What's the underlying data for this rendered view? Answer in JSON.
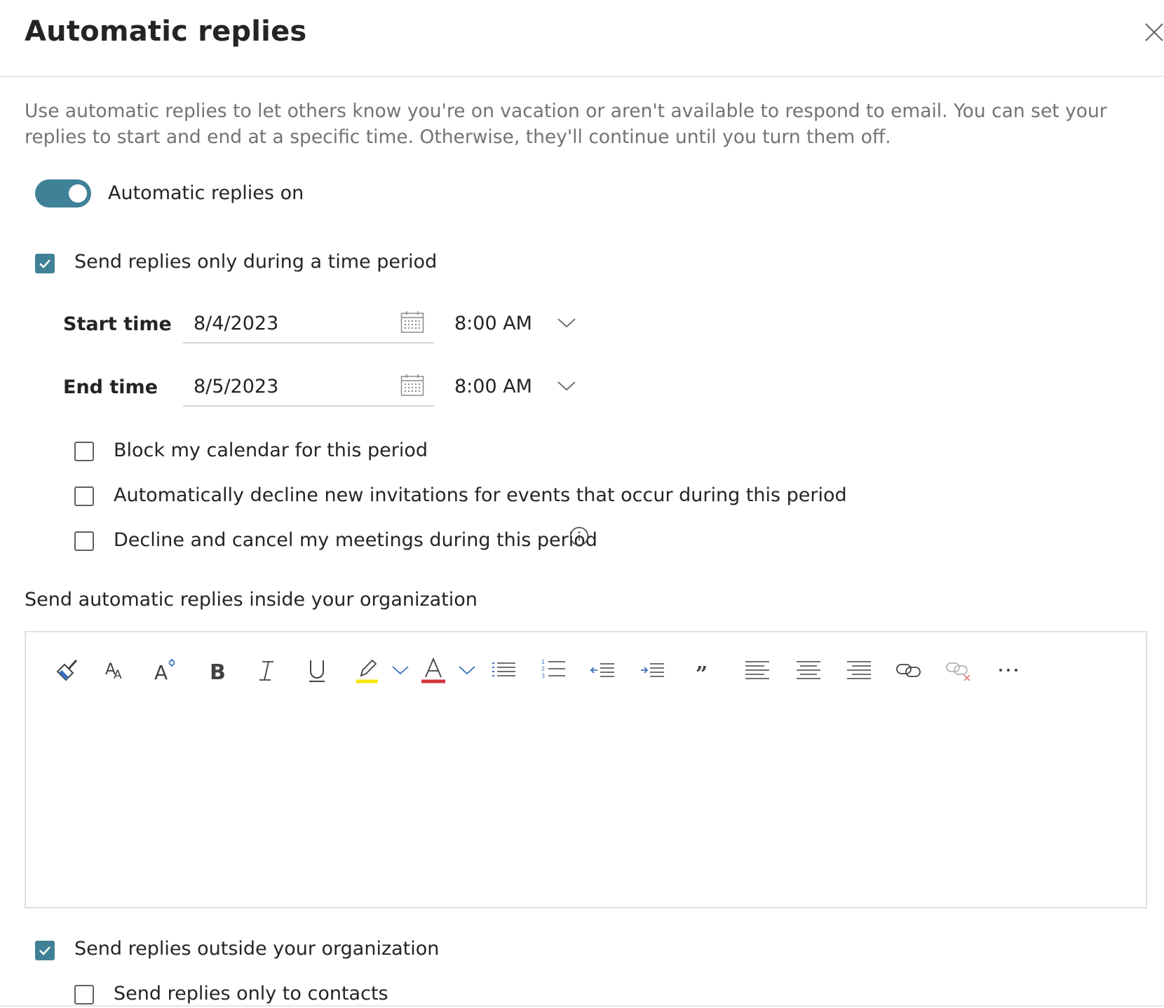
{
  "dialog": {
    "title": "Automatic replies",
    "description": "Use automatic replies to let others know you're on vacation or aren't available to respond to email. You can set your replies to start and end at a specific time. Otherwise, they'll continue until you turn them off."
  },
  "toggle": {
    "label": "Automatic replies on",
    "on": true
  },
  "time_period": {
    "label": "Send replies only during a time period",
    "checked": true,
    "start": {
      "label": "Start time",
      "date": "8/4/2023",
      "time": "8:00 AM"
    },
    "end": {
      "label": "End time",
      "date": "8/5/2023",
      "time": "8:00 AM"
    }
  },
  "options": [
    {
      "label": "Block my calendar for this period",
      "checked": false
    },
    {
      "label": "Automatically decline new invitations for events that occur during this period",
      "checked": false
    },
    {
      "label": "Decline and cancel my meetings during this period",
      "checked": false
    }
  ],
  "inside_section": {
    "label": "Send automatic replies inside your organization"
  },
  "toolbar": [
    "format-painter-icon",
    "font-size-icon",
    "grow-font-icon",
    "bold-icon",
    "italic-icon",
    "underline-icon",
    "highlight-icon",
    "font-color-icon",
    "bullets-icon",
    "numbering-icon",
    "decrease-indent-icon",
    "increase-indent-icon",
    "quote-icon",
    "align-left-icon",
    "align-center-icon",
    "align-right-icon",
    "link-icon",
    "remove-link-icon",
    "more-icon"
  ],
  "colors": {
    "accent": "#3f8196",
    "highlight": "#f5e700",
    "font_color": "#d13438"
  },
  "outside": {
    "label": "Send replies outside your organization",
    "checked": true,
    "contacts_only": {
      "label": "Send replies only to contacts",
      "checked": false
    }
  }
}
